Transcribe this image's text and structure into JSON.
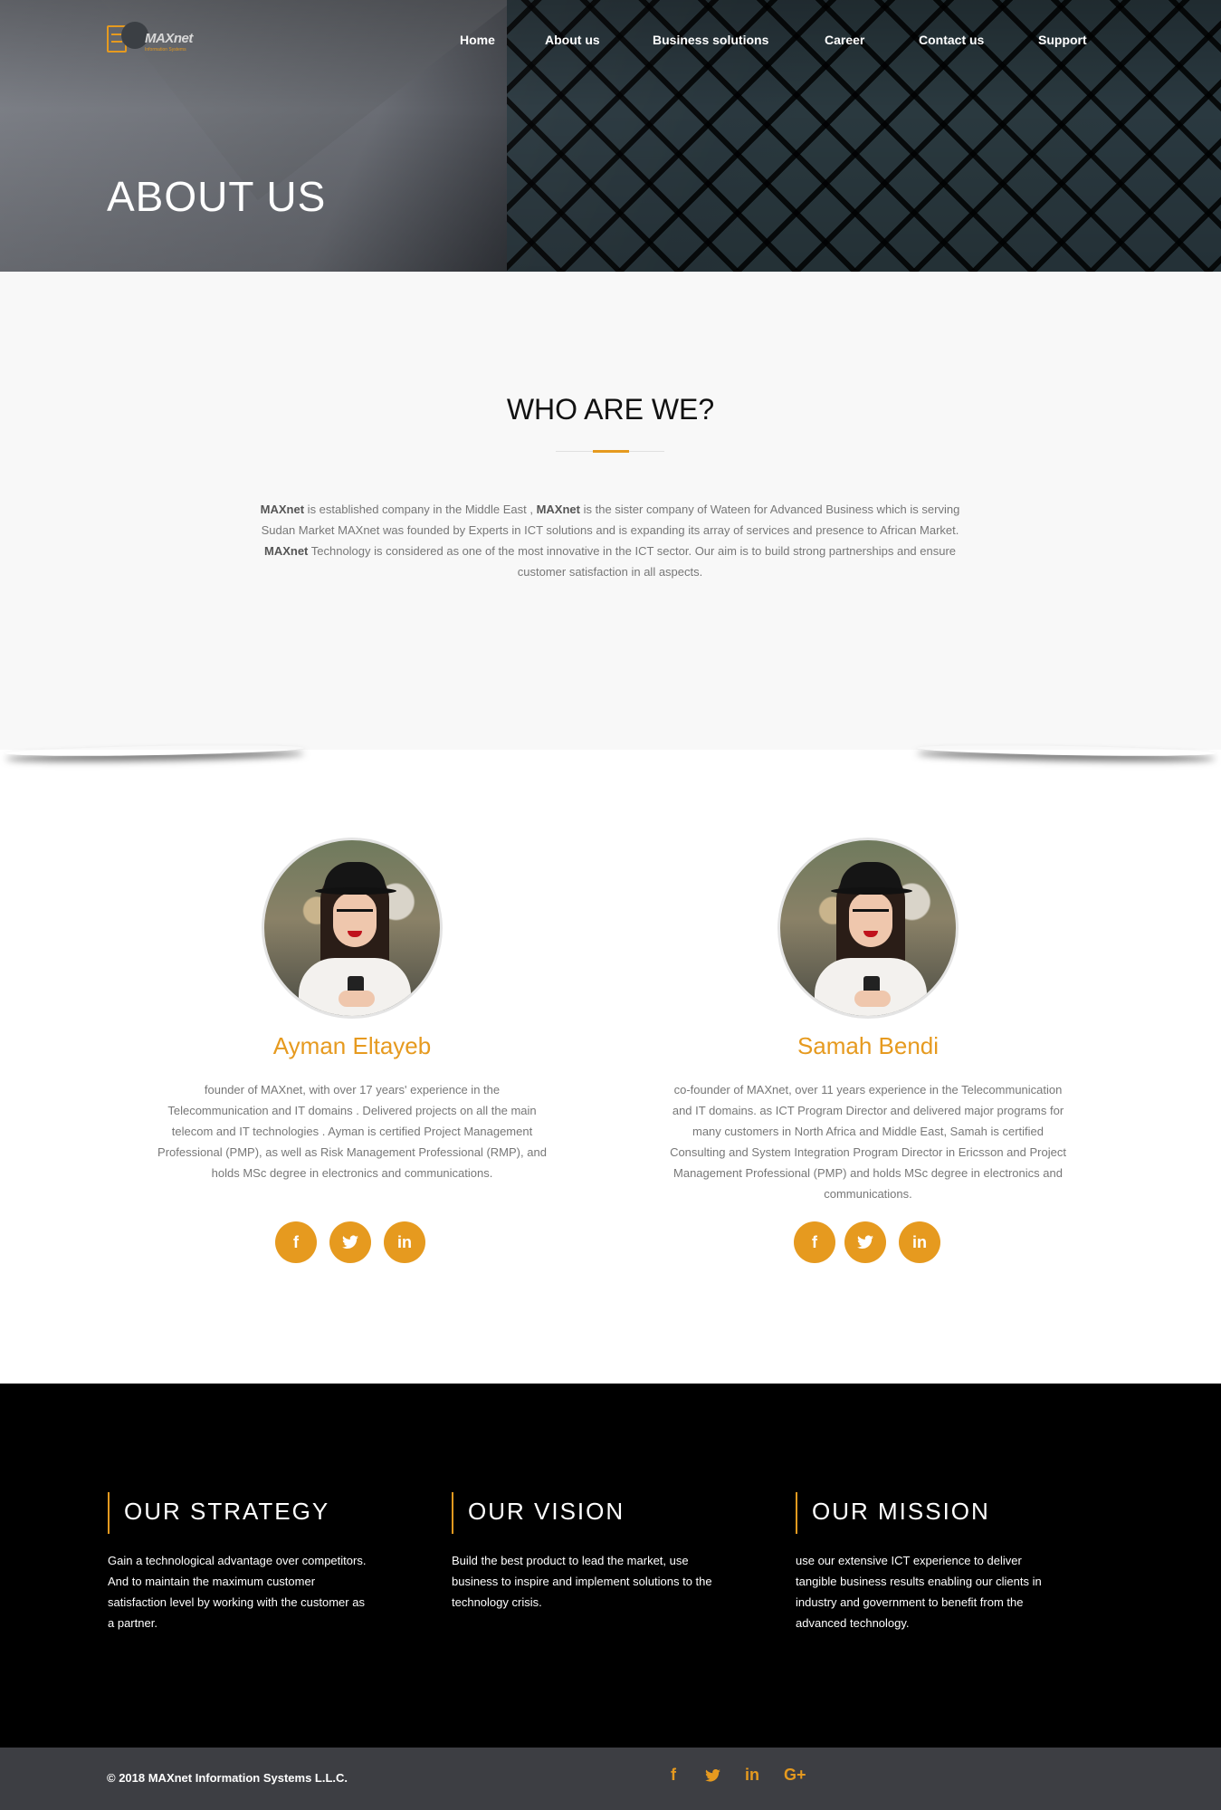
{
  "brand": {
    "name": "MAXnet",
    "tagline": "Information Systems",
    "accent": "#e69a1f"
  },
  "nav": {
    "items": [
      "Home",
      "About us",
      "Business solutions",
      "Career",
      "Contact us",
      "Support"
    ]
  },
  "hero": {
    "title": "ABOUT US"
  },
  "who": {
    "title": "WHO ARE WE?",
    "p1_b1": "MAXnet",
    "p1_t1": " is established company in the Middle East , ",
    "p1_b2": "MAXnet",
    "p1_t2": " is the sister company of Wateen for Advanced Business which is serving Sudan Market MAXnet was founded by Experts in ICT solutions and is expanding its array of services and presence to African Market.",
    "p2_b1": "MAXnet",
    "p2_t1": " Technology is considered as one of the most innovative in the ICT sector. Our aim is to build strong partnerships and ensure customer satisfaction in all aspects."
  },
  "team": [
    {
      "name": "Ayman Eltayeb",
      "bio": "founder of MAXnet, with over 17 years' experience in the Telecommunication and IT domains . Delivered projects on all the main telecom and IT technologies . Ayman is certified Project Management Professional (PMP), as well as Risk Management Professional (RMP), and holds MSc degree in electronics and communications.",
      "socials": [
        "f",
        "t",
        "in"
      ]
    },
    {
      "name": "Samah Bendi",
      "bio": "co-founder of MAXnet, over 11 years experience in the Telecommunication and IT domains. as ICT Program Director and delivered major programs for many customers in North Africa and Middle East, Samah is certified Consulting and System Integration Program Director in Ericsson and Project Management Professional (PMP) and holds MSc degree in electronics and communications.",
      "socials": [
        "f",
        "t",
        "in"
      ]
    }
  ],
  "pillars": [
    {
      "title": "OUR STRATEGY",
      "text": "Gain a technological advantage over competitors. And to maintain the maximum customer satisfaction level by working with the customer as a partner."
    },
    {
      "title": "OUR VISION",
      "text": "Build the best product to lead the market, use business to inspire and implement solutions to the technology crisis."
    },
    {
      "title": "OUR MISSION",
      "text": "use our extensive ICT experience to deliver tangible business results enabling our clients in industry and government to benefit from the advanced technology."
    }
  ],
  "footer": {
    "copyright": "© 2018 MAXnet Information Systems L.L.C.",
    "icons": [
      "f",
      "t",
      "in",
      "G+"
    ]
  },
  "icons": {
    "facebook": "facebook-icon",
    "twitter": "twitter-icon",
    "linkedin": "linkedin-icon",
    "googleplus": "google-plus-icon"
  }
}
